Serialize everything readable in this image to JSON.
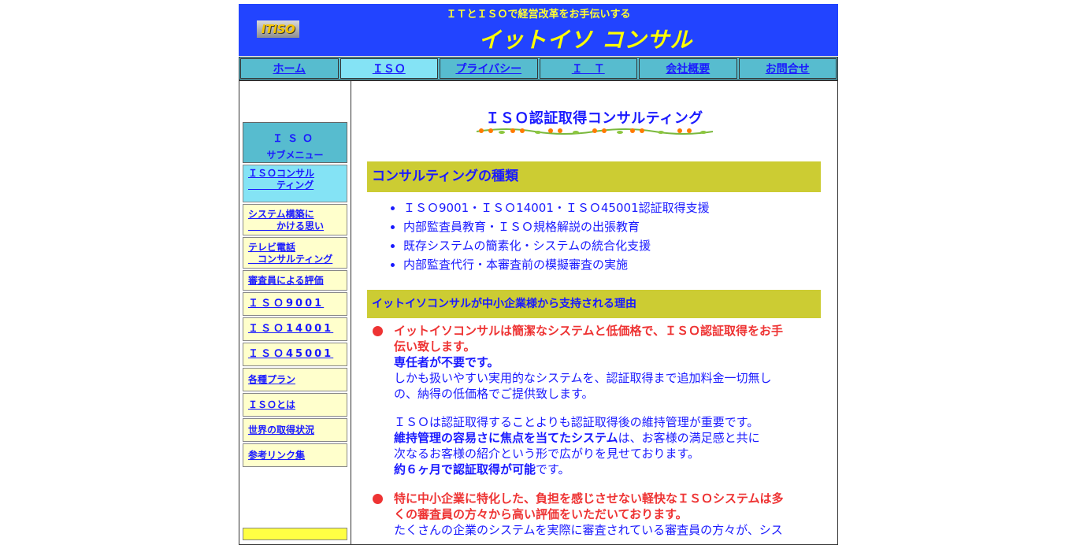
{
  "header": {
    "logo_text": "ITISO",
    "tagline": "ＩＴとＩＳＯで経営改革をお手伝いする",
    "brand": "イットイソ コンサル"
  },
  "nav": {
    "items": [
      "ホーム",
      "ＩＳＯ",
      "プライバシー",
      "Ｉ　Ｔ",
      "会社概要",
      "お問合せ"
    ],
    "active": "ＩＳＯ"
  },
  "sidebar": {
    "heading_line1": "ＩＳＯ",
    "heading_line2": "サブメニュー",
    "items": [
      {
        "l1": "ＩＳＯコンサル",
        "l2": "　　　ティング"
      },
      {
        "l1": "システム構築に",
        "l2": "　　　かける思い"
      },
      {
        "l1": "テレビ電話",
        "l2": "　コンサルティング"
      },
      {
        "l1": "審査員による評価"
      },
      {
        "l1": "ＩＳＯ9001"
      },
      {
        "l1": "ＩＳＯ14001"
      },
      {
        "l1": "ＩＳＯ45001"
      },
      {
        "l1": "各種プラン"
      },
      {
        "l1": "ＩＳＯとは"
      },
      {
        "l1": "世界の取得状況"
      },
      {
        "l1": "参考リンク集"
      }
    ]
  },
  "main": {
    "title": "ＩＳＯ認証取得コンサルティング",
    "section1_title": "コンサルティングの種類",
    "bullets": [
      "ＩＳＯ9001・ＩＳＯ14001・ＩＳＯ45001認証取得支援",
      "内部監査員教育・ＩＳＯ規格解説の出張教育",
      "既存システムの簡素化・システムの統合化支援",
      "内部監査代行・本審査前の模擬審査の実施"
    ],
    "section2_title": "イットイソコンサルが中小企業様から支持される理由",
    "reason1": {
      "heading_a": "イットイソコンサルは簡潔なシステムと低価格で、ＩＳＯ認証取得をお手",
      "heading_b": "伝い致します。",
      "sub": "専任者が不要です。",
      "text_a": "しかも扱いやすい実用的なシステムを、認証取得まで追加料金一切無し",
      "text_b": "の、納得の低価格でご提供致します。",
      "p2_a": "ＩＳＯは認証取得することよりも認証取得後の維持管理が重要です。",
      "p2_b_bold": "維持管理の容易さに焦点を当てたシステム",
      "p2_b_rest": "は、お客様の満足感と共に",
      "p2_c": "次なるお客様の紹介という形で広がりを見せております。",
      "p2_d_bold": "約６ヶ月で認証取得が可能",
      "p2_d_rest": "です。"
    },
    "reason2": {
      "heading_a": "特に中小企業に特化した、負担を感じさせない軽快なＩＳＯシステムは多",
      "heading_b": "くの審査員の方々から高い評価をいただいております。",
      "text_a": "たくさんの企業のシステムを実際に審査されている審査員の方々が、シス"
    }
  },
  "colors": {
    "header_bg": "#2244ff",
    "brand_yellow": "#ffff00",
    "nav_bg": "#57bccf",
    "nav_active_bg": "#84e3f5",
    "band_olive": "#cccc33",
    "link_blue": "#1a1aff",
    "accent_red": "#ee3333",
    "side_item_bg": "#ffffcc"
  }
}
